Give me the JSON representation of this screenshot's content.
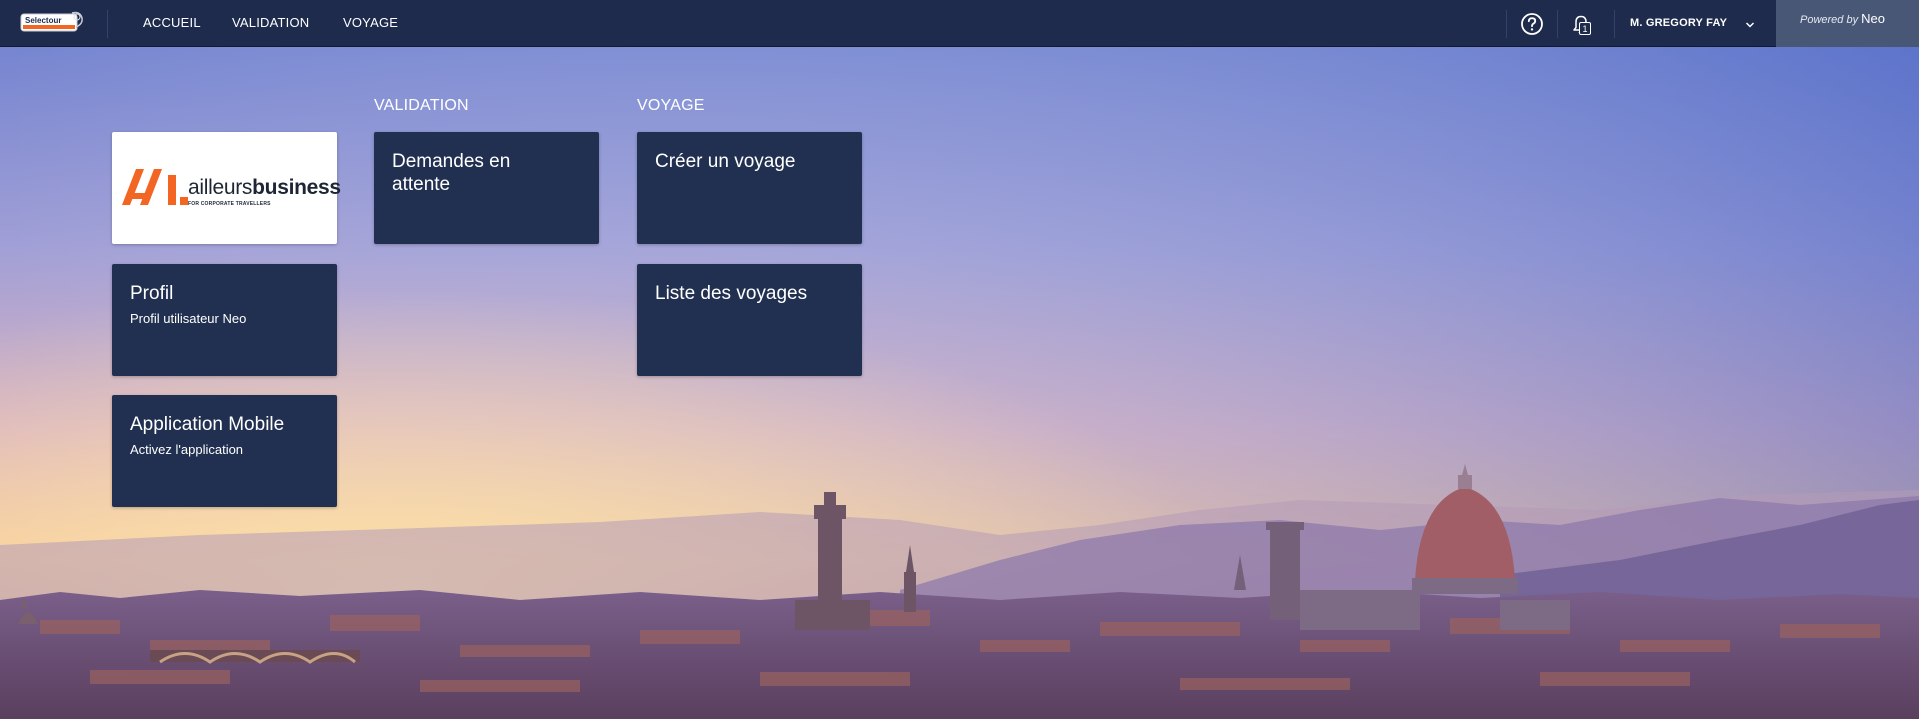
{
  "header": {
    "logo_text": "Selectour",
    "nav": [
      {
        "label": "ACCUEIL"
      },
      {
        "label": "VALIDATION"
      },
      {
        "label": "VOYAGE"
      }
    ],
    "notification_count": "1",
    "user_name": "M. GREGORY FAY",
    "powered_by": "Powered by",
    "powered_brand": "Neo"
  },
  "sections": {
    "validation_title": "VALIDATION",
    "voyage_title": "VOYAGE"
  },
  "tiles": {
    "brand": {
      "main_light": "ailleurs",
      "main_bold": "business",
      "tagline": "FOR CORPORATE TRAVELLERS"
    },
    "profil": {
      "title": "Profil",
      "subtitle": "Profil utilisateur Neo"
    },
    "mobile": {
      "title": "Application Mobile",
      "subtitle": "Activez l'application"
    },
    "pending": {
      "title": "Demandes en attente"
    },
    "create_trip": {
      "title": "Créer un voyage"
    },
    "trip_list": {
      "title": "Liste des voyages"
    }
  },
  "colors": {
    "nav_bg": "#1e2b4c",
    "tile_bg": "#213050",
    "brand_orange": "#f26522"
  }
}
